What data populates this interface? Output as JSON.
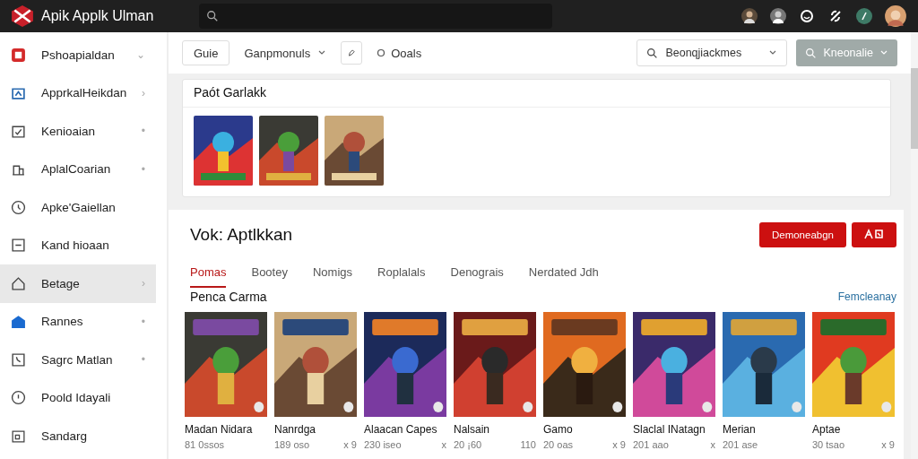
{
  "app": {
    "title": "Apik Applk Ulman"
  },
  "sidebar": {
    "items": [
      {
        "label": "Pshoapialdan",
        "selected": false,
        "chevron": "⌄"
      },
      {
        "label": "ApprkalHeikdan",
        "selected": false,
        "chevron": "›"
      },
      {
        "label": "Kenioaian",
        "selected": false,
        "chevron": "•"
      },
      {
        "label": "AplalCoarian",
        "selected": false,
        "chevron": "•"
      },
      {
        "label": "Apke'Gaiellan",
        "selected": false
      },
      {
        "label": "Kand hioaan",
        "selected": false
      },
      {
        "label": "Betage",
        "selected": true,
        "chevron": "›"
      },
      {
        "label": "Rannes",
        "selected": false,
        "chevron": "•"
      },
      {
        "label": "Sagrc Matlan",
        "selected": false,
        "chevron": "•"
      },
      {
        "label": "Poold Idayali",
        "selected": false
      },
      {
        "label": "Sandarg",
        "selected": false
      }
    ]
  },
  "toolbar": {
    "button": "Guie",
    "dropdown": "Ganpmonuls",
    "options": "Ooals",
    "filter": "Beonqjiackmes",
    "action": "Kneonalie"
  },
  "recent": {
    "title": "Paót Garlakk"
  },
  "panel": {
    "title": "Vok: Aptlkkan",
    "primary_button": "Demoneabgn",
    "tabs": [
      {
        "label": "Pomas",
        "selected": true
      },
      {
        "label": "Bootey",
        "selected": false
      },
      {
        "label": "Nomigs",
        "selected": false
      },
      {
        "label": "Roplalals",
        "selected": false
      },
      {
        "label": "Denograis",
        "selected": false
      },
      {
        "label": "Nerdated Jdh",
        "selected": false
      }
    ],
    "section": {
      "title": "Penca Carma",
      "link": "Femcleanay"
    },
    "games": [
      {
        "title": "Madan Nidara",
        "meta": "81 0ssos"
      },
      {
        "title": "Nanrdga",
        "meta": "189 oso",
        "extra": "x 9"
      },
      {
        "title": "Alaacan Capes",
        "meta": "230 iseo",
        "extra": "x"
      },
      {
        "title": "Nalsain",
        "meta": "20 ¡60",
        "extra": "110"
      },
      {
        "title": "Gamo",
        "meta": "20 oas",
        "extra": "x 9"
      },
      {
        "title": "Slaclal INatagn",
        "meta": "201 aao",
        "extra": "x"
      },
      {
        "title": "Merian",
        "meta": "201 ase"
      },
      {
        "title": "Aptae",
        "meta": "30 tsao",
        "extra": "x 9"
      }
    ]
  }
}
